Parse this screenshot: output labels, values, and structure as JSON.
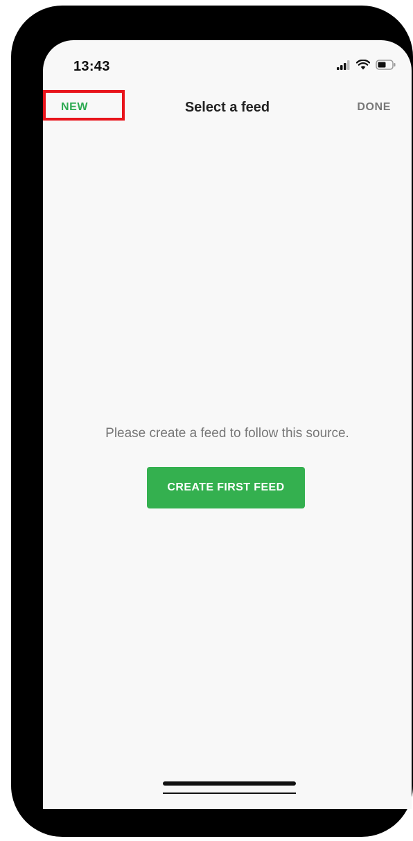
{
  "status_bar": {
    "time": "13:43",
    "icons": [
      "signal-icon",
      "wifi-icon",
      "battery-icon"
    ]
  },
  "nav": {
    "left_label": "NEW",
    "title": "Select a feed",
    "right_label": "DONE"
  },
  "empty_state": {
    "message": "Please create a feed to follow this source.",
    "button_label": "CREATE FIRST FEED"
  },
  "colors": {
    "accent_green": "#34b04f",
    "new_label_green": "#2eaa52",
    "highlight_red": "#e8141b",
    "screen_background": "#f8f8f8"
  }
}
